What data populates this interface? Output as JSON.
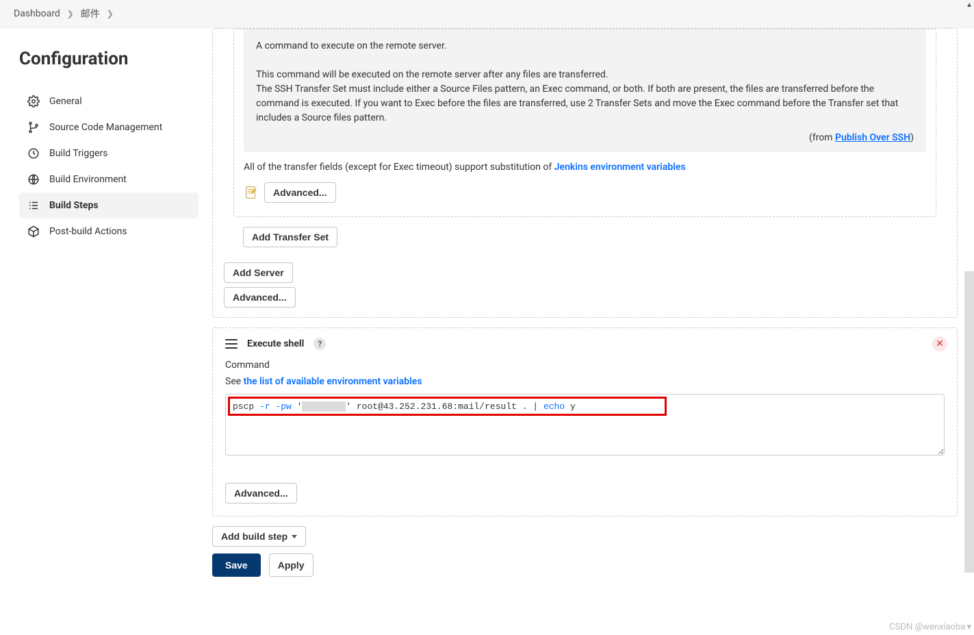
{
  "breadcrumbs": {
    "dashboard": "Dashboard",
    "item": "邮件"
  },
  "sidebar": {
    "title": "Configuration",
    "items": [
      {
        "label": "General"
      },
      {
        "label": "Source Code Management"
      },
      {
        "label": "Build Triggers"
      },
      {
        "label": "Build Environment"
      },
      {
        "label": "Build Steps"
      },
      {
        "label": "Post-build Actions"
      }
    ]
  },
  "ssh_help": {
    "line1": "A command to execute on the remote server.",
    "line2": "This command will be executed on the remote server after any files are transferred.",
    "line3": "The SSH Transfer Set must include either a Source Files pattern, an Exec command, or both. If both are present, the files are transferred before the command is executed. If you want to Exec before the files are transferred, use 2 Transfer Sets and move the Exec command before the Transfer set that includes a Source files pattern.",
    "from_prefix": "(from ",
    "from_link": "Publish Over SSH",
    "from_suffix": ")",
    "subst_prefix": "All of the transfer fields (except for Exec timeout) support substitution of ",
    "subst_link": "Jenkins environment variables"
  },
  "buttons": {
    "advanced": "Advanced...",
    "add_transfer_set": "Add Transfer Set",
    "add_server": "Add Server",
    "add_build_step": "Add build step",
    "save": "Save",
    "apply": "Apply"
  },
  "shell": {
    "title": "Execute shell",
    "help": "?",
    "command_label": "Command",
    "see_prefix": "See ",
    "see_link": "the list of available environment variables",
    "code_prefix": "pscp ",
    "code_flag1": "-r",
    "code_space": " ",
    "code_flag2": "-pw",
    "code_mid": " root@43.252.231.68:mail/result . | ",
    "code_echo": "echo",
    "code_y": " y"
  },
  "watermark": "CSDN @wenxiaoba"
}
